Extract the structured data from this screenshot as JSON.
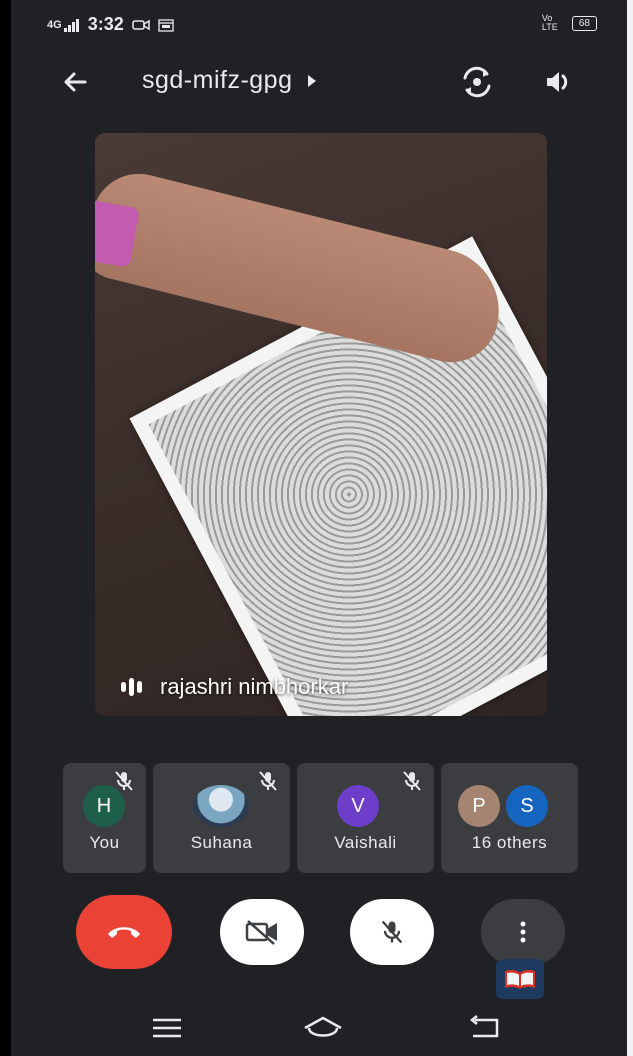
{
  "status_bar": {
    "network": "4G",
    "time": "3:32",
    "volte": "Vo LTE",
    "battery": "68"
  },
  "header": {
    "meeting_code": "sgd-mifz-gpg"
  },
  "main_video": {
    "speaker_name": "rajashri nimbhorkar"
  },
  "participants": [
    {
      "name": "You",
      "initial": "H",
      "color": "#1e5f4a",
      "muted": true
    },
    {
      "name": "Suhana",
      "initial": "",
      "color": "#7aa6c2",
      "muted": true
    },
    {
      "name": "Vaishali",
      "initial": "V",
      "color": "#6d3ec9",
      "muted": true
    },
    {
      "name": "16 others",
      "initials": [
        "P",
        "S"
      ],
      "colors": [
        "#a58471",
        "#1565c0"
      ],
      "muted": false
    }
  ],
  "controls": {
    "end_call_color": "#ea4335",
    "watermark_icon": "book-icon"
  },
  "colors": {
    "background": "#202124",
    "tile": "#3c3d40"
  }
}
